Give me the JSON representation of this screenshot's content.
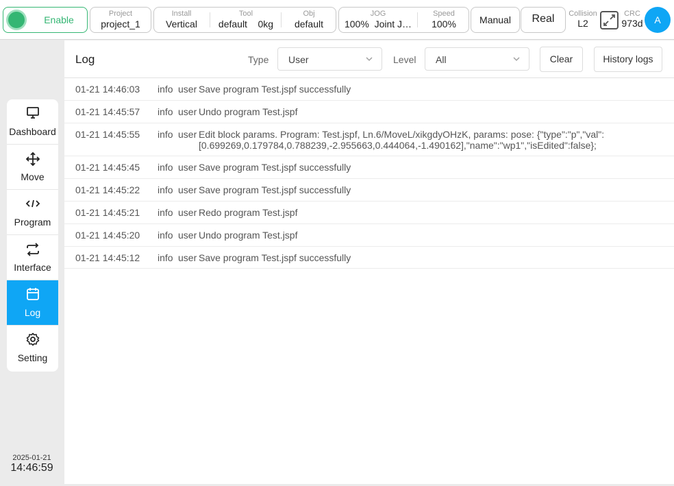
{
  "topbar": {
    "enable_label": "Enable",
    "project": {
      "key": "Project",
      "value": "project_1"
    },
    "install": {
      "key": "Install",
      "value": "Vertical"
    },
    "tool": {
      "key": "Tool",
      "value": "default",
      "weight": "0kg"
    },
    "obj": {
      "key": "Obj",
      "value": "default"
    },
    "jog": {
      "key": "JOG",
      "value": "100%",
      "mode": "Joint J…"
    },
    "speed": {
      "key": "Speed",
      "value": "100%"
    },
    "manual_label": "Manual",
    "real_label": "Real",
    "collision": {
      "key": "Collision",
      "value": "L2"
    },
    "crc": {
      "key": "CRC",
      "value": "973d"
    },
    "avatar_initial": "A"
  },
  "sidebar": {
    "items": [
      {
        "label": "Dashboard",
        "icon": "monitor-icon",
        "active": false
      },
      {
        "label": "Move",
        "icon": "move-arrows-icon",
        "active": false
      },
      {
        "label": "Program",
        "icon": "code-icon",
        "active": false
      },
      {
        "label": "Interface",
        "icon": "repeat-icon",
        "active": false
      },
      {
        "label": "Log",
        "icon": "calendar-icon",
        "active": true
      },
      {
        "label": "Setting",
        "icon": "gear-icon",
        "active": false
      }
    ]
  },
  "clock": {
    "date": "2025-01-21",
    "time": "14:46:59"
  },
  "log": {
    "title": "Log",
    "type_label": "Type",
    "type_value": "User",
    "level_label": "Level",
    "level_value": "All",
    "clear_label": "Clear",
    "history_label": "History logs",
    "entries": [
      {
        "time": "01-21 14:46:03",
        "level": "info",
        "user": "user",
        "message": "Save program Test.jspf successfully"
      },
      {
        "time": "01-21 14:45:57",
        "level": "info",
        "user": "user",
        "message": "Undo program Test.jspf"
      },
      {
        "time": "01-21 14:45:55",
        "level": "info",
        "user": "user",
        "message": "Edit block params. Program: Test.jspf, Ln.6/MoveL/xikgdyOHzK, params: pose: {\"type\":\"p\",\"val\":[0.699269,0.179784,0.788239,-2.955663,0.444064,-1.490162],\"name\":\"wp1\",\"isEdited\":false};"
      },
      {
        "time": "01-21 14:45:45",
        "level": "info",
        "user": "user",
        "message": "Save program Test.jspf successfully"
      },
      {
        "time": "01-21 14:45:22",
        "level": "info",
        "user": "user",
        "message": "Save program Test.jspf successfully"
      },
      {
        "time": "01-21 14:45:21",
        "level": "info",
        "user": "user",
        "message": "Redo program Test.jspf"
      },
      {
        "time": "01-21 14:45:20",
        "level": "info",
        "user": "user",
        "message": "Undo program Test.jspf"
      },
      {
        "time": "01-21 14:45:12",
        "level": "info",
        "user": "user",
        "message": "Save program Test.jspf successfully"
      }
    ]
  },
  "colors": {
    "accent": "#0fa6f5",
    "enabled": "#34b673"
  }
}
